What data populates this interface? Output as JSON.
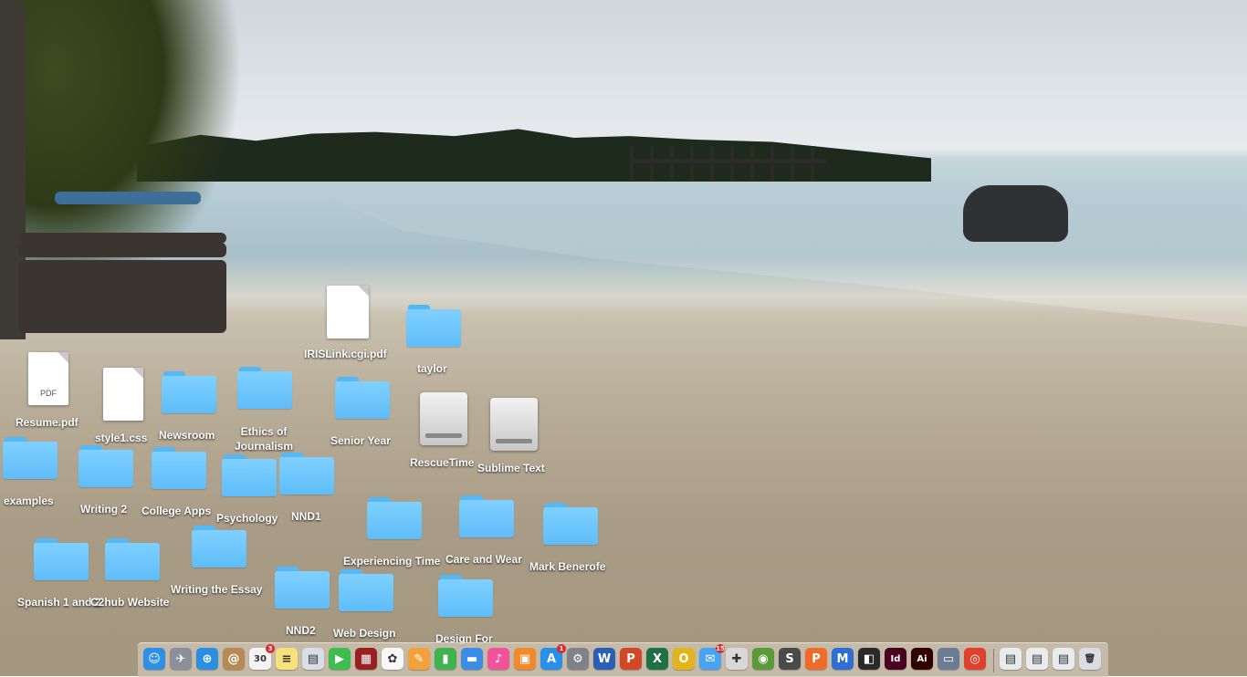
{
  "desktop": {
    "files": [
      {
        "label": "IRISLink.cgi.pdf"
      },
      {
        "label": "Resume.pdf",
        "doc_text": "PDF"
      },
      {
        "label": "style1.css"
      }
    ],
    "folders": [
      {
        "label": "taylor"
      },
      {
        "label": "Newsroom"
      },
      {
        "label": "Ethics of Journalism"
      },
      {
        "label": "Senior Year"
      },
      {
        "label": "examples"
      },
      {
        "label": "Writing 2"
      },
      {
        "label": "College Apps"
      },
      {
        "label": "Psychology"
      },
      {
        "label": "NND1"
      },
      {
        "label": "Experiencing Time"
      },
      {
        "label": "Care and Wear"
      },
      {
        "label": "Mark Benerofe"
      },
      {
        "label": "Spanish 1 and 2"
      },
      {
        "label": "C2hub Website"
      },
      {
        "label": "Writing the Essay"
      },
      {
        "label": "NND2"
      },
      {
        "label": "Web Design"
      },
      {
        "label": "Design For"
      }
    ],
    "drives": [
      {
        "label": "RescueTime"
      },
      {
        "label": "Sublime Text"
      }
    ]
  },
  "dock": {
    "items": [
      {
        "name": "finder-icon",
        "glyph": "☺",
        "color": "#2f8fe8"
      },
      {
        "name": "launchpad-icon",
        "glyph": "✈",
        "color": "#8a8f99"
      },
      {
        "name": "safari-icon",
        "glyph": "⊕",
        "color": "#2a8fe0"
      },
      {
        "name": "contacts-icon",
        "glyph": "@",
        "color": "#b68a55"
      },
      {
        "name": "calendar-icon",
        "glyph": "30",
        "color": "#f4f4f4",
        "badge": "3"
      },
      {
        "name": "notes-icon",
        "glyph": "≡",
        "color": "#f5e27a"
      },
      {
        "name": "preview-icon",
        "glyph": "▤",
        "color": "#d7dee6"
      },
      {
        "name": "facetime-icon",
        "glyph": "▶",
        "color": "#3fbd4e"
      },
      {
        "name": "photo-booth-icon",
        "glyph": "▦",
        "color": "#9a1f1f"
      },
      {
        "name": "photos-icon",
        "glyph": "✿",
        "color": "#f8f8f8"
      },
      {
        "name": "pages-icon",
        "glyph": "✎",
        "color": "#f3a23b"
      },
      {
        "name": "numbers-icon",
        "glyph": "▮",
        "color": "#3fb34f"
      },
      {
        "name": "keynote-icon",
        "glyph": "▬",
        "color": "#3a8ee6"
      },
      {
        "name": "itunes-icon",
        "glyph": "♪",
        "color": "#f0539a"
      },
      {
        "name": "ibooks-icon",
        "glyph": "▣",
        "color": "#f08a2a"
      },
      {
        "name": "app-store-icon",
        "glyph": "A",
        "color": "#2a8fe8",
        "badge": "1"
      },
      {
        "name": "system-preferences-icon",
        "glyph": "⚙",
        "color": "#7f8389"
      },
      {
        "name": "word-icon",
        "glyph": "W",
        "color": "#2b5fb3"
      },
      {
        "name": "powerpoint-icon",
        "glyph": "P",
        "color": "#d24726"
      },
      {
        "name": "excel-icon",
        "glyph": "X",
        "color": "#1e7145"
      },
      {
        "name": "opera-icon",
        "glyph": "O",
        "color": "#e3b41b"
      },
      {
        "name": "messages-icon",
        "glyph": "✉",
        "color": "#4aa3f0",
        "badge": "15"
      },
      {
        "name": "rescue-app-icon",
        "glyph": "✚",
        "color": "#d8d8d8"
      },
      {
        "name": "network-globe-icon",
        "glyph": "◉",
        "color": "#5a9a3a"
      },
      {
        "name": "sublime-text-icon",
        "glyph": "S",
        "color": "#4a4a4a"
      },
      {
        "name": "pocket-app-icon",
        "glyph": "P",
        "color": "#ef6b2a"
      },
      {
        "name": "malwarebytes-icon",
        "glyph": "M",
        "color": "#2f6fd4"
      },
      {
        "name": "screen-app-icon",
        "glyph": "◧",
        "color": "#2a2a2a"
      },
      {
        "name": "indesign-icon",
        "glyph": "Id",
        "color": "#49021f"
      },
      {
        "name": "illustrator-icon",
        "glyph": "Ai",
        "color": "#330000"
      },
      {
        "name": "image-capture-icon",
        "glyph": "▭",
        "color": "#6c7c93"
      },
      {
        "name": "chrome-icon",
        "glyph": "◎",
        "color": "#e2402f"
      },
      {
        "name": "downloads-stack-icon",
        "glyph": "▤",
        "color": "#e8ecef"
      },
      {
        "name": "documents-stack-icon",
        "glyph": "▤",
        "color": "#e8ecef"
      },
      {
        "name": "desktop-stack-icon",
        "glyph": "▤",
        "color": "#e8ecef"
      },
      {
        "name": "trash-icon",
        "glyph": "🗑",
        "color": "#d9dde1"
      }
    ]
  }
}
